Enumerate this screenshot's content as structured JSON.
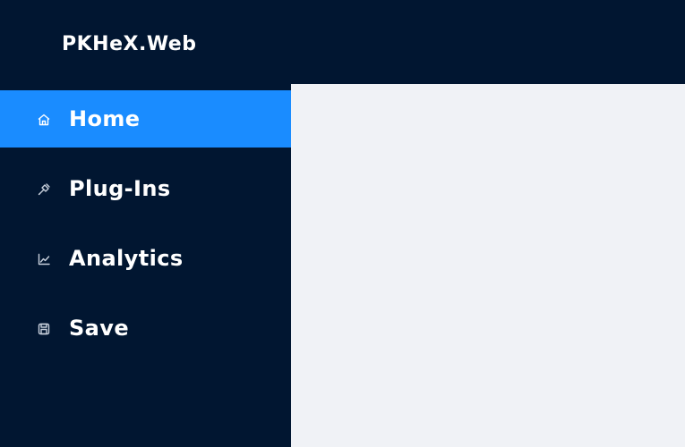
{
  "app": {
    "title": "PKHeX.Web"
  },
  "sidebar": {
    "items": [
      {
        "label": "Home",
        "icon": "home-icon",
        "active": true
      },
      {
        "label": "Plug-Ins",
        "icon": "plug-icon",
        "active": false
      },
      {
        "label": "Analytics",
        "icon": "chart-icon",
        "active": false
      },
      {
        "label": "Save",
        "icon": "save-icon",
        "active": false
      }
    ]
  },
  "colors": {
    "background": "#011631",
    "accent": "#1a8cff",
    "content": "#f0f2f6",
    "text": "#ffffff",
    "icon": "#c8d0dc"
  }
}
